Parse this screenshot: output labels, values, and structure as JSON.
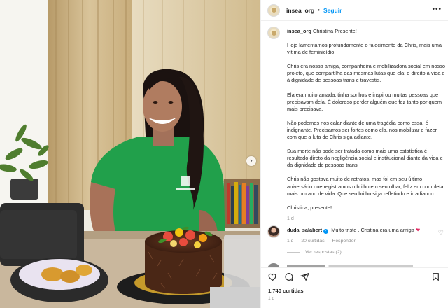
{
  "post": {
    "username": "insea_org",
    "separator": "•",
    "follow_label": "Seguir",
    "more_label": "•••",
    "next_label": "›",
    "caption": {
      "username": "insea_org",
      "first_line": "Christina Presente!",
      "paragraphs": [
        "Hoje lamentamos profundamente o falecimento da Chris, mais uma vítima de feminicídio.",
        "Chris era nossa amiga, companheira e mobilizadora social em nosso projeto, que compartilha das mesmas lutas que ela: o direito à vida e à dignidade de pessoas trans e travestis.",
        "Ela era muito amada, tinha sonhos e inspirou muitas pessoas que precisavam dela. É doloroso perder alguém que fez tanto por quem mais precisava.",
        "Não podemos nos calar diante de uma tragédia como essa, é indignante. Precisamos ser fortes como ela, nos mobilizar e fazer com que a luta de Chris siga adiante.",
        "Sua morte não pode ser tratada como mais uma estatística é resultado direto da negligência social e institucional diante da vida e da dignidade de pessoas trans.",
        "Chris não gostava muito de retratos, mas foi em seu último aniversário que registramos o brilho em seu olhar, feliz em completar mais um ano de vida. Que seu brilho siga refletindo e irradiando.",
        "Christina, presente!"
      ],
      "time": "1 d"
    },
    "comment": {
      "username": "duda_salabert",
      "verified_mark": "✓",
      "text": "Muito triste . Cristina era uma amiga",
      "heart": "❤",
      "time": "1 d",
      "likes": "20 curtidas",
      "reply_label": "Responder",
      "view_replies": "Ver respostas (2)",
      "like_icon": "♡"
    },
    "likes_count": "1.740 curtidas",
    "posted_ago": "1 d",
    "icons": [
      "heart-icon",
      "comment-icon",
      "share-icon",
      "bookmark-icon"
    ]
  }
}
